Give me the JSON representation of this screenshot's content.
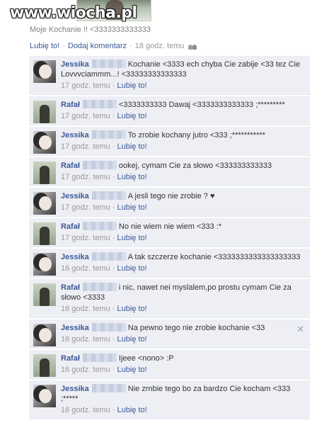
{
  "watermark": "www.wiocha.pl",
  "caption": "Moje Kochanie !! <3333333333333",
  "actions": {
    "like": "Lubię to!",
    "comment": "Dodaj komentarz",
    "time": "18 godz. temu"
  },
  "comments": [
    {
      "author": "Jessika",
      "avatar": "jessika",
      "text": "Kochanie <3333 ech chyba Cie zabije <33 tez Cie Lovvvciammm...! <33333333333333",
      "time": "17 godz. temu",
      "like": "Lubię to!"
    },
    {
      "author": "Rafał",
      "avatar": "rafal",
      "text": "<3333333333 Dawaj <3333333333333 ;*********",
      "time": "17 godz. temu",
      "like": "Lubię to!"
    },
    {
      "author": "Jessika",
      "avatar": "jessika",
      "text": "To zrobie kochany jutro <333 ;***********",
      "time": "17 godz. temu",
      "like": "Lubię to!"
    },
    {
      "author": "Rafał",
      "avatar": "rafal",
      "text": "ookej, cymam Cie za słowo <333333333333",
      "time": "17 godz. temu",
      "like": "Lubię to!"
    },
    {
      "author": "Jessika",
      "avatar": "jessika",
      "text": "A jesli tego nie zrobie ? ♥",
      "time": "17 godz. temu",
      "like": "Lubię to!"
    },
    {
      "author": "Rafał",
      "avatar": "rafal",
      "text": "No nie wiem nie wiem <333 :*",
      "time": "17 godz. temu",
      "like": "Lubię to!"
    },
    {
      "author": "Jessika",
      "avatar": "jessika",
      "text": "A tak szczerze kochanie <3333333333333333333",
      "time": "16 godz. temu",
      "like": "Lubię to!"
    },
    {
      "author": "Rafał",
      "avatar": "rafal",
      "text": "i nic, nawet nei myslalem,po prostu cymam Cie za słowo <3333",
      "time": "16 godz. temu",
      "like": "Lubię to!"
    },
    {
      "author": "Jessika",
      "avatar": "jessika",
      "text": "Na pewno tego nie zrobie kochanie <33",
      "time": "16 godz. temu",
      "like": "Lubię to!",
      "close": "✕"
    },
    {
      "author": "Rafał",
      "avatar": "rafal",
      "text": "Ijeee <nono> :P",
      "time": "16 godz. temu",
      "like": "Lubię to!"
    },
    {
      "author": "Jessika",
      "avatar": "jessika",
      "text": "Nie zrnbie tego bo za bardzo Cie kocham <333 ;*****",
      "time": "16 godz. temu",
      "like": "Lubię to!"
    }
  ]
}
